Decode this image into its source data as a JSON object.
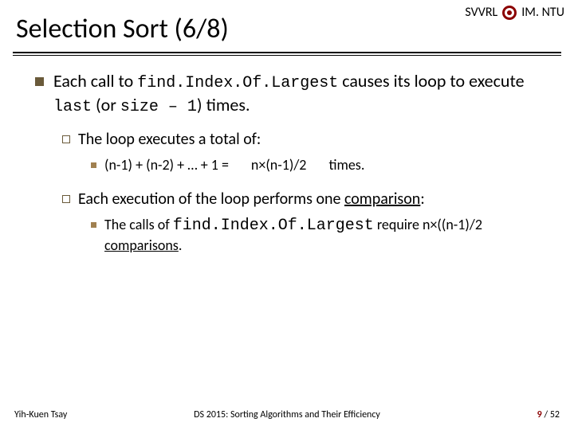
{
  "header": {
    "brand_left": "SVVRL",
    "brand_right": "IM. NTU",
    "title": "Selection Sort (6/8)"
  },
  "main": {
    "line1_pre": "Each call to ",
    "line1_code": "find.Index.Of.Largest",
    "line1_mid": " causes its loop to execute ",
    "line2_code1": "last",
    "line2_mid": " (or ",
    "line2_code2": "size – 1",
    "line2_post": ") times.",
    "sub1": "The loop executes a total of:",
    "eq_left": "(n-1) + (n-2) + … + 1 =",
    "eq_mid": "n×(n-1)/2",
    "eq_right": "times.",
    "sub2_pre": "Each execution of the loop performs one ",
    "sub2_u": "comparison",
    "sub2_post": ":",
    "sub2b_pre": "The calls of ",
    "sub2b_code": "find.Index.Of.Largest",
    "sub2b_mid": " require n×((n-1)/2 ",
    "sub2b_u": "comparisons",
    "sub2b_post": "."
  },
  "footer": {
    "left": "Yih-Kuen Tsay",
    "center": "DS 2015: Sorting Algorithms and Their Efficiency",
    "page_current": "9",
    "page_sep": " / ",
    "page_total": "52"
  }
}
